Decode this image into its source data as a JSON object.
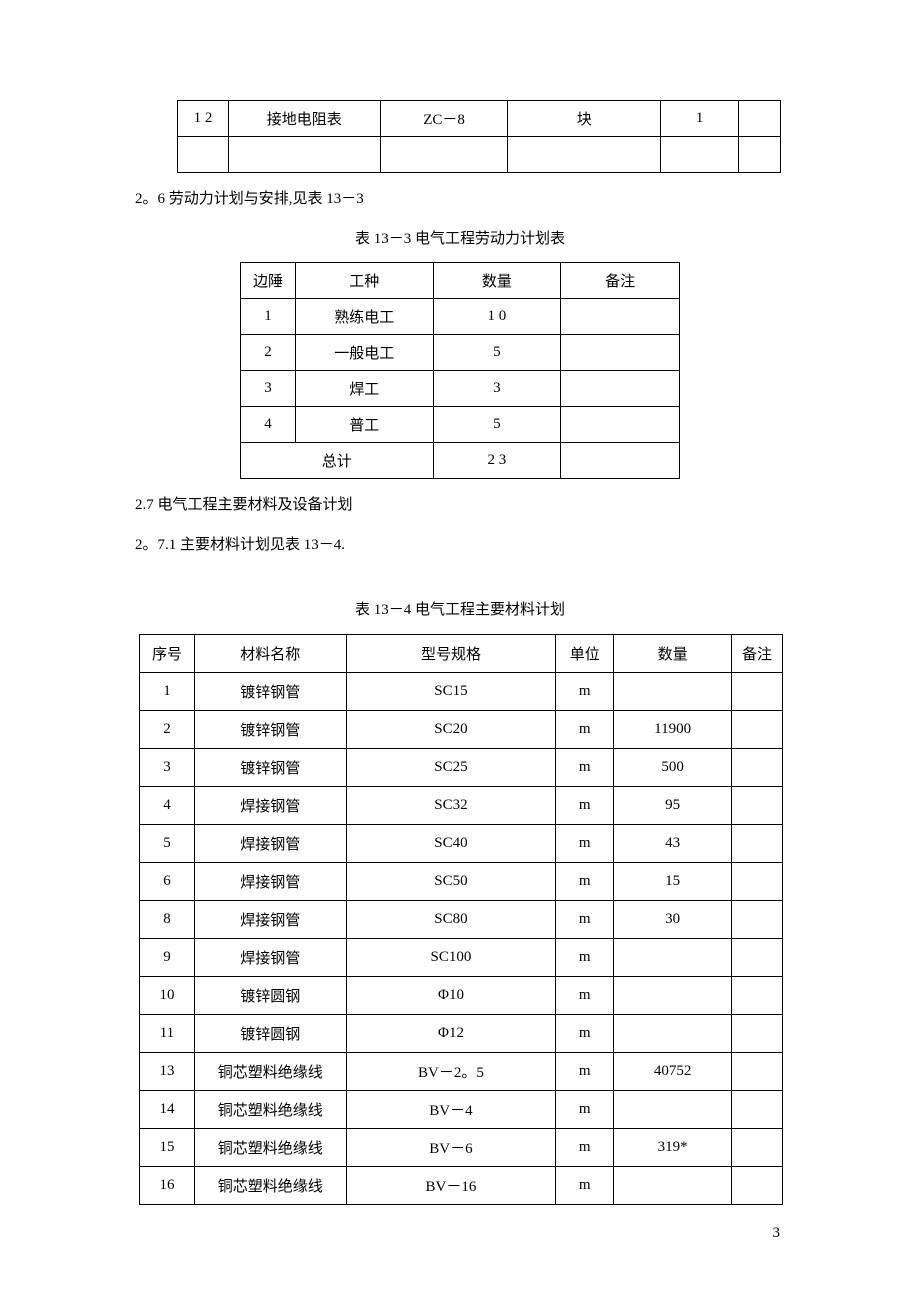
{
  "table1": {
    "rows": [
      {
        "c1": "1 2",
        "c2": "接地电阻表",
        "c3": "ZC－8",
        "c4": "块",
        "c5": "1",
        "c6": ""
      },
      {
        "c1": "",
        "c2": "",
        "c3": "",
        "c4": "",
        "c5": "",
        "c6": ""
      }
    ]
  },
  "para1": "2。6 劳动力计划与安排,见表 13－3",
  "table2": {
    "title": "表 13－3 电气工程劳动力计划表",
    "headers": {
      "c1": "边陲",
      "c2": "工种",
      "c3": "数量",
      "c4": "备注"
    },
    "rows": [
      {
        "c1": "1",
        "c2": "熟练电工",
        "c3": "1 0",
        "c4": ""
      },
      {
        "c1": "2",
        "c2": "一般电工",
        "c3": "5",
        "c4": ""
      },
      {
        "c1": "3",
        "c2": "焊工",
        "c3": "3",
        "c4": ""
      },
      {
        "c1": "4",
        "c2": "普工",
        "c3": "5",
        "c4": ""
      }
    ],
    "footer": {
      "label": "总计",
      "total": "2 3",
      "note": ""
    }
  },
  "para2": "2.7 电气工程主要材料及设备计划",
  "para3": "2。7.1 主要材料计划见表 13－4.",
  "table3": {
    "title": "表 13－4 电气工程主要材料计划",
    "headers": {
      "c1": "序号",
      "c2": "材料名称",
      "c3": "型号规格",
      "c4": "单位",
      "c5": "数量",
      "c6": "备注"
    },
    "rows": [
      {
        "c1": "1",
        "c2": "镀锌钢管",
        "c3": "SC15",
        "c4": "m",
        "c5": "",
        "c6": ""
      },
      {
        "c1": "2",
        "c2": "镀锌钢管",
        "c3": "SC20",
        "c4": "m",
        "c5": "11900",
        "c6": ""
      },
      {
        "c1": "3",
        "c2": "镀锌钢管",
        "c3": "SC25",
        "c4": "m",
        "c5": "500",
        "c6": ""
      },
      {
        "c1": "4",
        "c2": "焊接钢管",
        "c3": "SC32",
        "c4": "m",
        "c5": "95",
        "c6": ""
      },
      {
        "c1": "5",
        "c2": "焊接钢管",
        "c3": "SC40",
        "c4": "m",
        "c5": "43",
        "c6": ""
      },
      {
        "c1": "6",
        "c2": "焊接钢管",
        "c3": "SC50",
        "c4": "m",
        "c5": "15",
        "c6": ""
      },
      {
        "c1": "8",
        "c2": "焊接钢管",
        "c3": "SC80",
        "c4": "m",
        "c5": "30",
        "c6": ""
      },
      {
        "c1": "9",
        "c2": "焊接钢管",
        "c3": "SC100",
        "c4": "m",
        "c5": "",
        "c6": ""
      },
      {
        "c1": "10",
        "c2": "镀锌圆钢",
        "c3": "Φ10",
        "c4": "m",
        "c5": "",
        "c6": ""
      },
      {
        "c1": "11",
        "c2": "镀锌圆钢",
        "c3": "Φ12",
        "c4": "m",
        "c5": "",
        "c6": ""
      },
      {
        "c1": "13",
        "c2": "铜芯塑料绝缘线",
        "c3": "BV－2。5",
        "c4": "m",
        "c5": "40752",
        "c6": ""
      },
      {
        "c1": "14",
        "c2": "铜芯塑料绝缘线",
        "c3": "BV－4",
        "c4": "m",
        "c5": "",
        "c6": ""
      },
      {
        "c1": "15",
        "c2": "铜芯塑料绝缘线",
        "c3": "BV－6",
        "c4": "m",
        "c5": "319*",
        "c6": ""
      },
      {
        "c1": "16",
        "c2": "铜芯塑料绝缘线",
        "c3": "BV－16",
        "c4": "m",
        "c5": "",
        "c6": ""
      }
    ]
  },
  "pageNumber": "3"
}
